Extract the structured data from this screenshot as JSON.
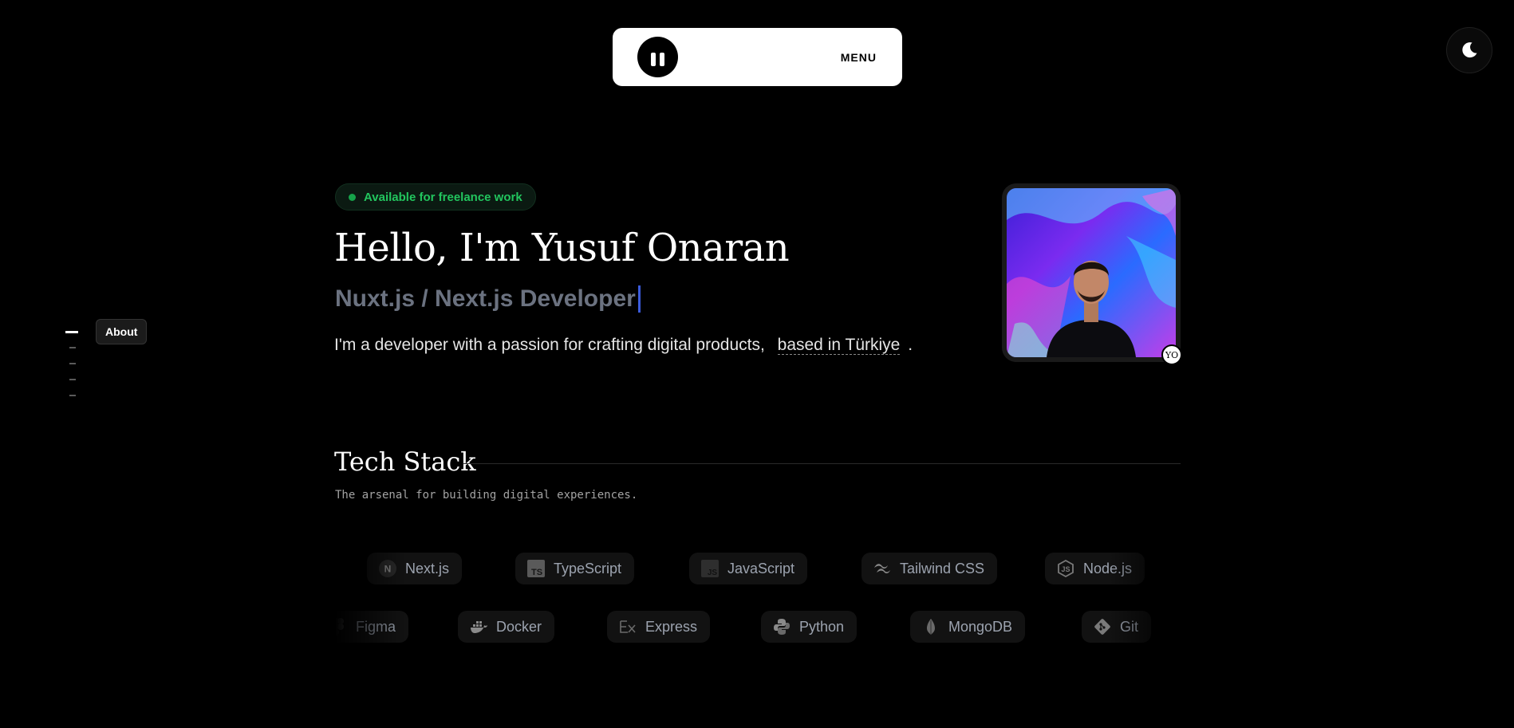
{
  "nav": {
    "menu_label": "MENU",
    "logo_icon": "pause-logo-icon",
    "theme_icon": "moon-icon"
  },
  "sidenav": {
    "active_label": "About",
    "sections_count": 5
  },
  "hero": {
    "status": "Available for freelance work",
    "title": "Hello, I'm Yusuf Onaran",
    "subtitle": "Nuxt.js / Next.js Developer",
    "desc_main": "I'm a developer with a passion for crafting digital products,",
    "desc_location": "based in Türkiye",
    "desc_end": ".",
    "avatar_badge": "YO"
  },
  "tech": {
    "title": "Tech Stack",
    "subtitle": "The arsenal for building digital experiences.",
    "row1": [
      {
        "label": "Next.js",
        "icon": "nextjs-icon"
      },
      {
        "label": "TypeScript",
        "icon": "typescript-icon"
      },
      {
        "label": "JavaScript",
        "icon": "javascript-icon"
      },
      {
        "label": "Tailwind CSS",
        "icon": "tailwind-icon"
      },
      {
        "label": "Node.js",
        "icon": "nodejs-icon"
      }
    ],
    "row2": [
      {
        "label": "Figma",
        "icon": "figma-icon"
      },
      {
        "label": "Docker",
        "icon": "docker-icon"
      },
      {
        "label": "Express",
        "icon": "express-icon"
      },
      {
        "label": "Python",
        "icon": "python-icon"
      },
      {
        "label": "MongoDB",
        "icon": "mongodb-icon"
      },
      {
        "label": "Git",
        "icon": "git-icon"
      }
    ]
  },
  "colors": {
    "accent_green": "#22c55e",
    "caret_blue": "#3b5bdb",
    "background": "#000000"
  }
}
